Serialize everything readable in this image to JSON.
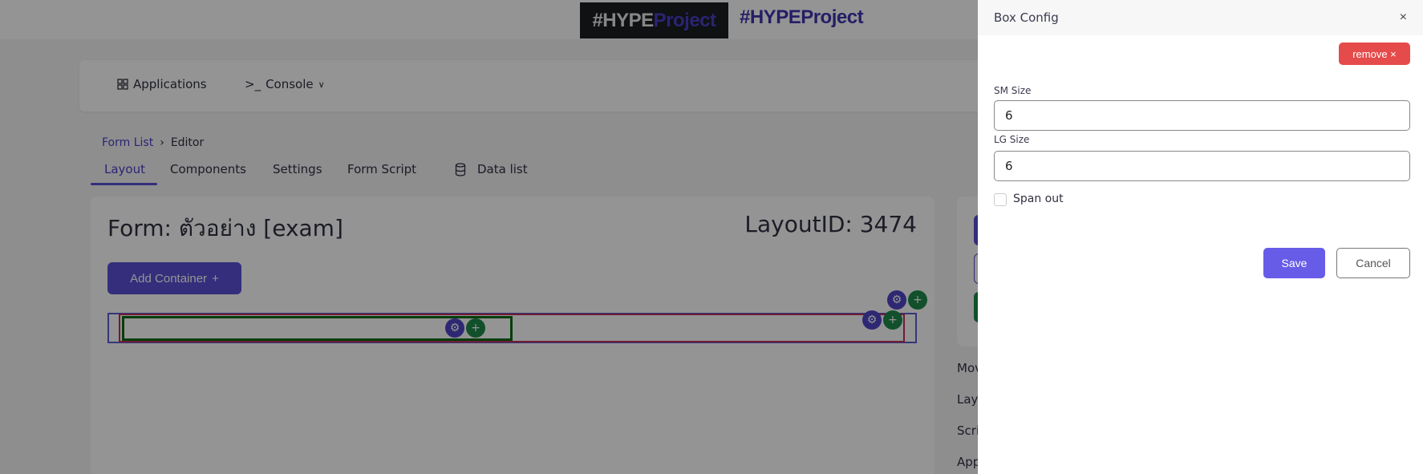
{
  "header": {
    "logo_part1": "#HYPE",
    "logo_part2": "Project",
    "brand_text": "#HYPEProject"
  },
  "nav": {
    "items": [
      {
        "label": "Applications",
        "icon": "grid-icon"
      },
      {
        "label": "Console",
        "icon": "terminal-icon"
      }
    ]
  },
  "breadcrumb": {
    "link": "Form List",
    "separator": "›",
    "current": "Editor"
  },
  "tabs": [
    {
      "label": "Layout",
      "active": true
    },
    {
      "label": "Components"
    },
    {
      "label": "Settings"
    },
    {
      "label": "Form Script"
    },
    {
      "label": "Data list",
      "icon": "database-icon"
    }
  ],
  "editor": {
    "title": "Form: ตัวอย่าง [exam]",
    "layout_id": "LayoutID: 3474",
    "add_container": "Add Container",
    "add_icon": "+",
    "gear_glyph": "⚙",
    "plus_glyph": "+"
  },
  "side_menu": [
    "Mov",
    "Lay",
    "Scri",
    "App"
  ],
  "drawer": {
    "title": "Box Config",
    "close": "×",
    "remove": "remove ×",
    "sm_label": "SM Size",
    "sm_value": "6",
    "lg_label": "LG Size",
    "lg_value": "6",
    "span_out": "Span out",
    "span_out_checked": false,
    "save": "Save",
    "cancel": "Cancel"
  },
  "colors": {
    "primary": "#5b50d6",
    "success": "#1f8a4c",
    "danger": "#e54b4b",
    "save": "#675ce8"
  }
}
